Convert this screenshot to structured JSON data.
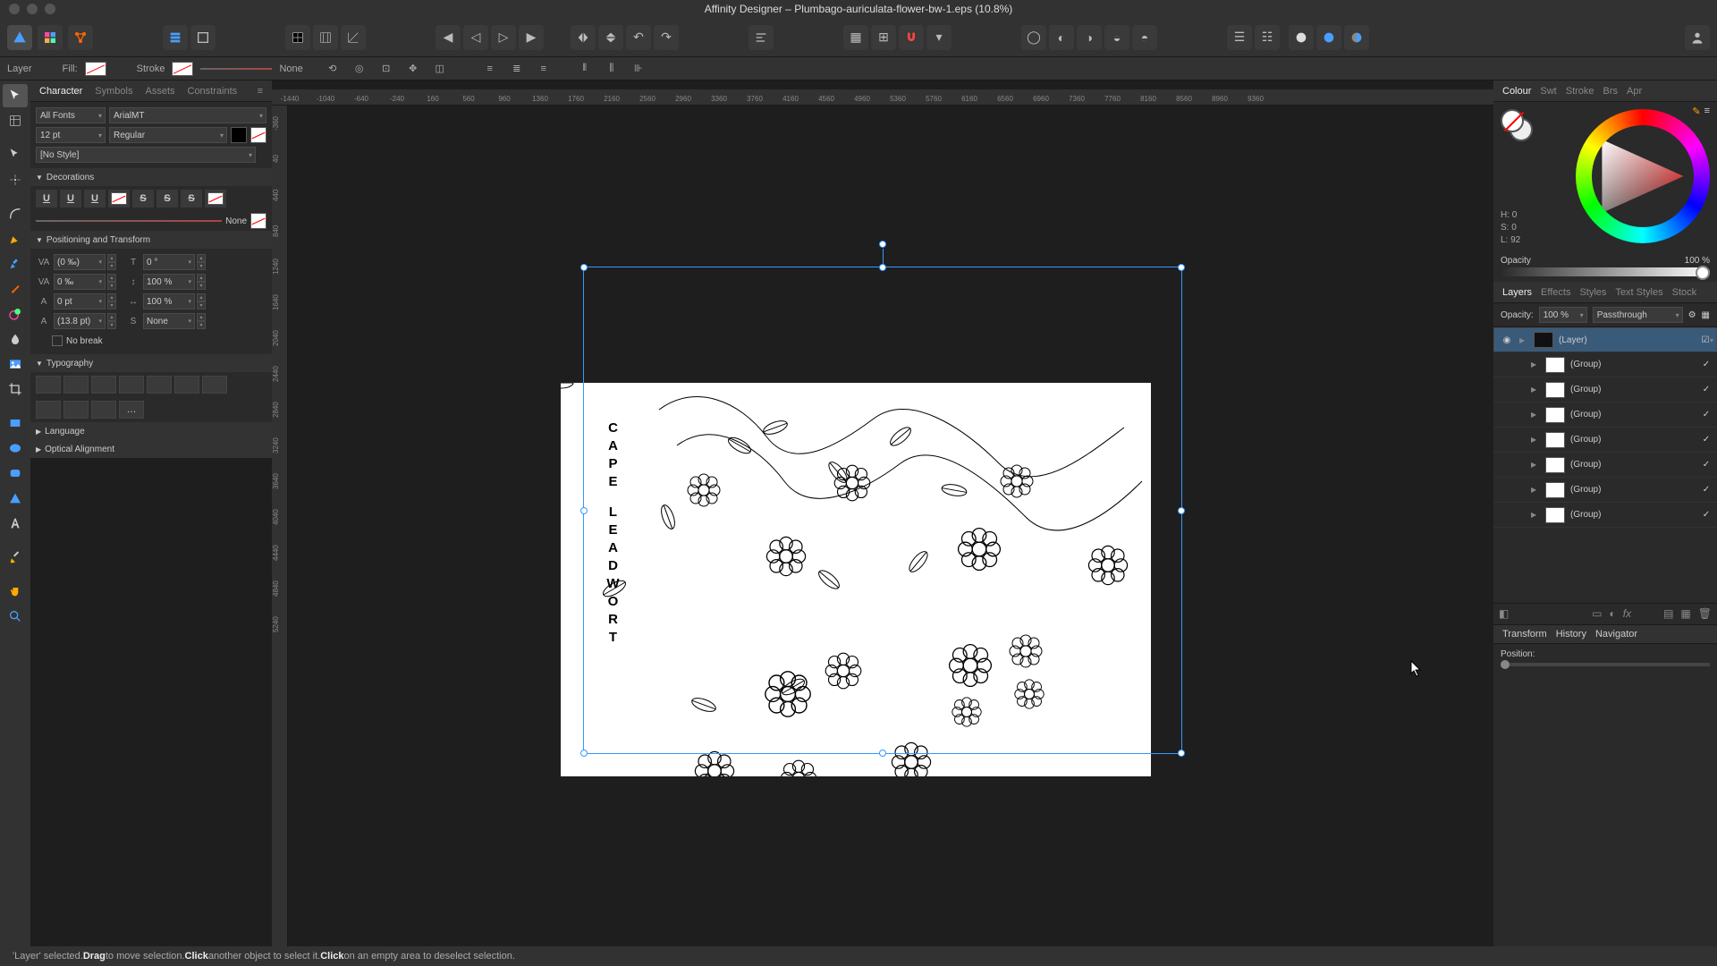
{
  "window": {
    "app": "Affinity Designer",
    "document": "Plumbago-auriculata-flower-bw-1.eps",
    "zoom": "10.8%",
    "title": "Affinity Designer – Plumbago-auriculata-flower-bw-1.eps (10.8%)"
  },
  "context_toolbar": {
    "layer_label": "Layer",
    "fill_label": "Fill:",
    "stroke_label": "Stroke",
    "stroke_width": "None"
  },
  "left_studio": {
    "tabs": [
      "Character",
      "Symbols",
      "Assets",
      "Constraints"
    ],
    "active_tab": "Character",
    "font_collection": "All Fonts",
    "font_family": "ArialMT",
    "font_size": "12 pt",
    "font_style": "Regular",
    "text_style": "[No Style]",
    "decorations_label": "Decorations",
    "deco_none": "None",
    "positioning_label": "Positioning and Transform",
    "tracking": "(0 ‰)",
    "kerning": "0 ‰",
    "baseline": "0 pt",
    "leading": "(13.8 pt)",
    "shear": "0 °",
    "hscale": "100 %",
    "vscale": "100 %",
    "spacing": "None",
    "nobreak_label": "No break",
    "typography_label": "Typography",
    "language_label": "Language",
    "optical_label": "Optical Alignment"
  },
  "ruler_h": [
    "-1440",
    "-1040",
    "-640",
    "-240",
    "160",
    "560",
    "960",
    "1360",
    "1760",
    "2160",
    "2560",
    "2960",
    "3360",
    "3760",
    "4160",
    "4560",
    "4960",
    "5360",
    "5760",
    "6160",
    "6560",
    "6960",
    "7360",
    "7760",
    "8160",
    "8560",
    "8960",
    "9360"
  ],
  "ruler_v": [
    "-360",
    "40",
    "440",
    "840",
    "1240",
    "1640",
    "2040",
    "2440",
    "2840",
    "3240",
    "3640",
    "4040",
    "4440",
    "4840",
    "5240"
  ],
  "artboard": {
    "title_line1": "LEADWORT",
    "title_line2": "CAPE"
  },
  "right": {
    "colour_tabs": [
      "Colour",
      "Swt",
      "Stroke",
      "Brs",
      "Apr"
    ],
    "colour_active": "Colour",
    "hsl": {
      "h": "H: 0",
      "s": "S: 0",
      "l": "L: 92"
    },
    "opacity_label": "Opacity",
    "opacity_value": "100 %",
    "layer_tabs": [
      "Layers",
      "Effects",
      "Styles",
      "Text Styles",
      "Stock"
    ],
    "layer_active": "Layers",
    "opacity_row_label": "Opacity:",
    "opacity_row_value": "100 %",
    "blend_mode": "Passthrough",
    "layers": [
      {
        "name": "(Layer)",
        "selected": true
      },
      {
        "name": "(Group)"
      },
      {
        "name": "(Group)"
      },
      {
        "name": "(Group)"
      },
      {
        "name": "(Group)"
      },
      {
        "name": "(Group)"
      },
      {
        "name": "(Group)"
      },
      {
        "name": "(Group)"
      }
    ],
    "history_tabs": [
      "Transform",
      "History",
      "Navigator"
    ],
    "history_active": "History",
    "position_label": "Position:"
  },
  "status": {
    "text_prefix": "'Layer' selected. ",
    "drag": "Drag",
    "text_mid": " to move selection. ",
    "click": "Click",
    "text_mid2": " another object to select it. ",
    "click2": "Click",
    "text_end": " on an empty area to deselect selection."
  }
}
